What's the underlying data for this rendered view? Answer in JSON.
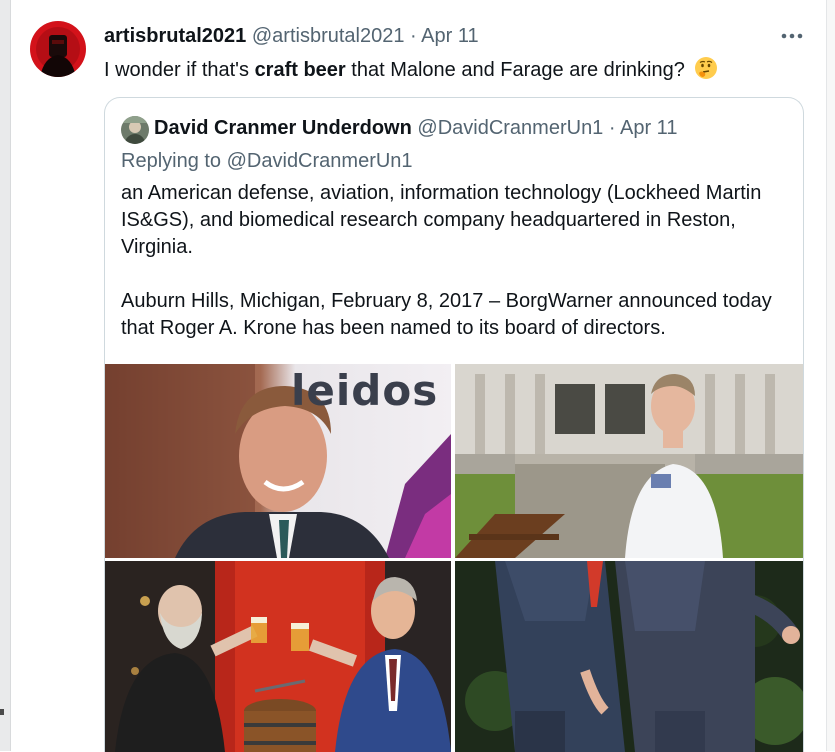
{
  "tweet": {
    "display_name": "artisbrutal2021",
    "handle": "@artisbrutal2021",
    "separator": "·",
    "date": "Apr 11",
    "text_before": "I wonder if that's ",
    "text_bold": "craft beer",
    "text_after": " that Malone and Farage are drinking?",
    "emoji": "thinking-face-icon",
    "more_icon": "more-dots-icon"
  },
  "quote": {
    "display_name": "David Cranmer Underdown",
    "handle": "@DavidCranmerUn1",
    "separator": "·",
    "date": "Apr 11",
    "replying_prefix": "Replying to ",
    "replying_handle": "@DavidCranmerUn1",
    "paragraphs": [
      "an American defense, aviation, information technology (Lockheed Martin IS&GS), and biomedical research company headquartered in Reston, Virginia.",
      "Auburn Hills, Michigan, February 8, 2017 – BorgWarner announced today that Roger A. Krone has been named to its board of directors."
    ],
    "media": [
      {
        "description": "leidos-photo",
        "sign_text": "leidos"
      },
      {
        "description": "lab-coat-man-photo"
      },
      {
        "description": "toast-beer-photo"
      },
      {
        "description": "men-walking-photo"
      }
    ]
  },
  "colors": {
    "text": "#0f1419",
    "muted": "#536471",
    "border": "#cfd9de"
  }
}
